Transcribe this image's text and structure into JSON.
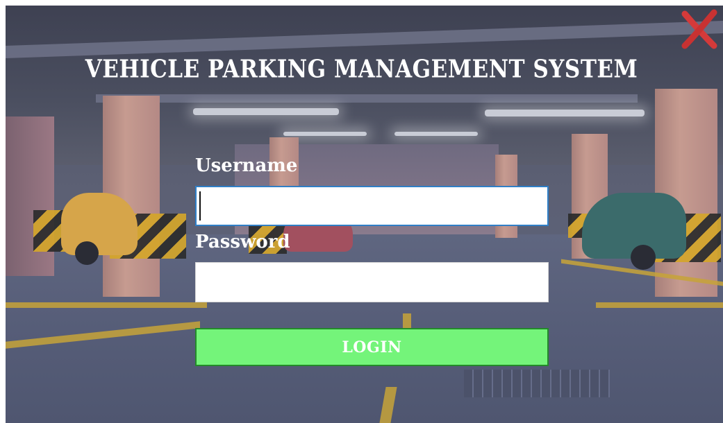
{
  "window": {
    "title": "VEHICLE PARKING MANAGEMENT SYSTEM",
    "close_icon": "close-x-icon",
    "close_color": "#d43a3a"
  },
  "form": {
    "username_label": "Username",
    "username_value": "",
    "password_label": "Password",
    "password_value": "",
    "login_label": "LOGIN",
    "login_color": "#74f47a"
  }
}
